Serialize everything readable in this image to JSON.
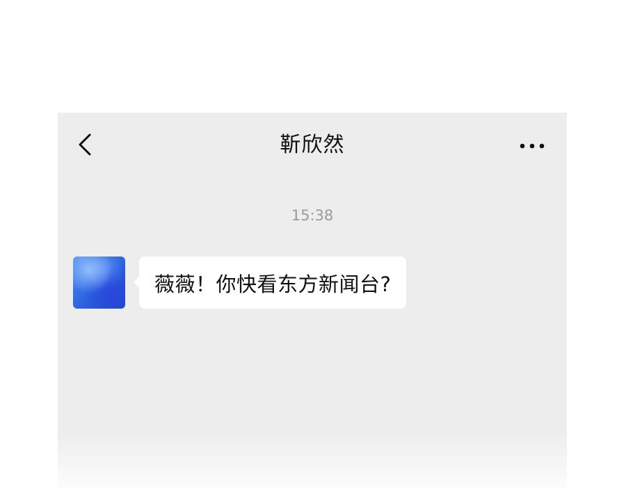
{
  "header": {
    "title": "靳欣然",
    "back_icon": "chevron-left-icon",
    "more_icon": "more-horizontal-icon"
  },
  "chat": {
    "timestamp": "15:38",
    "messages": [
      {
        "sender": "contact",
        "text": "薇薇！你快看东方新闻台?"
      }
    ]
  },
  "colors": {
    "background": "#ededed",
    "bubble": "#ffffff",
    "timestamp": "#9b9b9b",
    "avatar_blue": "#2d62e0"
  }
}
